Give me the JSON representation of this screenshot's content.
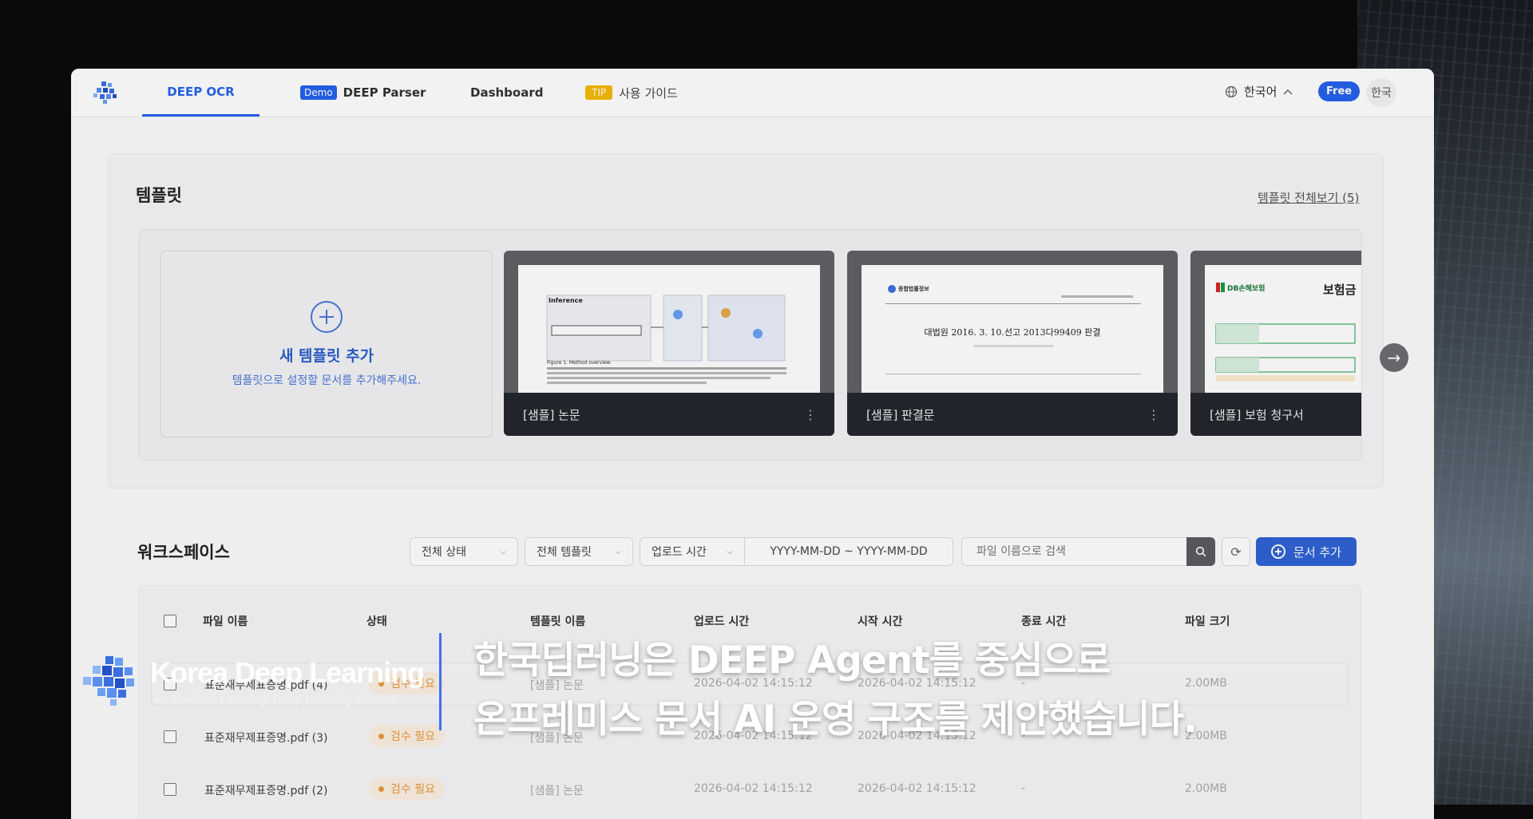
{
  "nav": {
    "tabs": [
      {
        "label": "DEEP OCR"
      },
      {
        "badge": "Demo",
        "label": "DEEP Parser"
      },
      {
        "label": "Dashboard"
      },
      {
        "badge": "TIP",
        "label": "사용 가이드"
      }
    ],
    "language": "한국어",
    "plan_badge": "Free",
    "user_initial": "한국"
  },
  "templates": {
    "title": "템플릿",
    "view_all": "템플릿 전체보기 (5)",
    "new_card": {
      "title": "새 템플릿 추가",
      "subtitle": "템플릿으로 설정할 문서를 추가해주세요."
    },
    "cards": [
      {
        "label": "[샘플] 논문",
        "preview_heading": "Inference",
        "preview_caption": "Figure 1. Method overview."
      },
      {
        "label": "[샘플] 판결문",
        "preview_heading": "대법원 2016. 3. 10.선고 2013다99409 판결",
        "preview_org": "종합법률정보"
      },
      {
        "label": "[샘플] 보험 청구서",
        "preview_heading": "보험금",
        "preview_org": "DB손해보험"
      }
    ]
  },
  "workspace": {
    "title": "워크스페이스",
    "filters": {
      "status": "전체 상태",
      "template": "전체 템플릿",
      "time": "업로드 시간",
      "date_range": "YYYY-MM-DD ~ YYYY-MM-DD"
    },
    "search_placeholder": "파일 이름으로 검색",
    "add_button": "문서 추가",
    "columns": [
      "파일 이름",
      "상태",
      "템플릿 이름",
      "업로드 시간",
      "시작 시간",
      "종료 시간",
      "파일 크기"
    ],
    "rows": [
      {
        "file": "표준재무제표증명.pdf (4)",
        "status": "검수 필요",
        "template": "[샘플] 논문",
        "uploaded": "2026-04-02 14:15:12",
        "started": "2026-04-02 14:15:12",
        "ended": "-",
        "size": "2.00MB"
      },
      {
        "file": "표준재무제표증명.pdf (3)",
        "status": "검수 필요",
        "template": "[샘플] 논문",
        "uploaded": "2026-04-02 14:15:12",
        "started": "2026-04-02 14:15:12",
        "ended": "-",
        "size": "2.00MB"
      },
      {
        "file": "표준재무제표증명.pdf (2)",
        "status": "검수 필요",
        "template": "[샘플] 논문",
        "uploaded": "2026-04-02 14:15:12",
        "started": "2026-04-02 14:15:12",
        "ended": "-",
        "size": "2.00MB"
      }
    ]
  },
  "overlay": {
    "brand": "Korea Deep Learning",
    "tagline": "AI, Machine Learning, Deep Learning Solution",
    "caption_lines": [
      "한국딥러닝은 DEEP Agent를 중심으로",
      "온프레미스 문서 AI 운영 구조를 제안했습니다."
    ]
  },
  "colors": {
    "accent": "#2563eb",
    "status": "#e89a3c",
    "tip": "#f5b800"
  }
}
